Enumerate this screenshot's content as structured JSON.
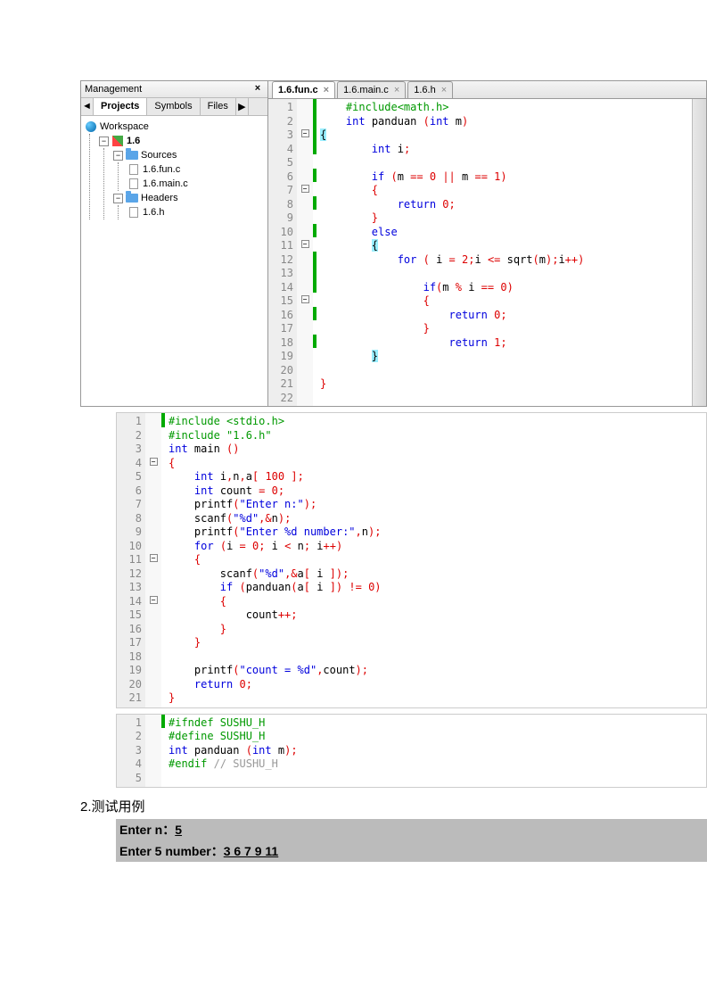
{
  "mgmt": {
    "title": "Management",
    "tabs": [
      "Projects",
      "Symbols",
      "Files"
    ],
    "active_tab": 0,
    "tree": {
      "workspace": "Workspace",
      "project": "1.6",
      "sources": "Sources",
      "source_files": [
        "1.6.fun.c",
        "1.6.main.c"
      ],
      "headers": "Headers",
      "header_files": [
        "1.6.h"
      ]
    }
  },
  "editor": {
    "tabs": [
      {
        "label": "1.6.fun.c",
        "active": true
      },
      {
        "label": "1.6.main.c",
        "active": false
      },
      {
        "label": "1.6.h",
        "active": false
      }
    ]
  },
  "code1": {
    "lines": [
      {
        "n": 1,
        "fold": "",
        "chg": "g",
        "tokens": [
          [
            "    ",
            ""
          ],
          [
            "#include<math.h>",
            "kw-pp"
          ]
        ]
      },
      {
        "n": 2,
        "fold": "",
        "chg": "g",
        "tokens": [
          [
            "    ",
            ""
          ],
          [
            "int",
            "kw-blue"
          ],
          [
            " panduan ",
            ""
          ],
          [
            "(",
            "kw-red"
          ],
          [
            "int",
            "kw-blue"
          ],
          [
            " m",
            ""
          ],
          [
            ")",
            "kw-red"
          ]
        ]
      },
      {
        "n": 3,
        "fold": "-",
        "chg": "g",
        "tokens": [
          [
            "{",
            "kw-hl"
          ]
        ]
      },
      {
        "n": 4,
        "fold": "",
        "chg": "g",
        "tokens": [
          [
            "        ",
            ""
          ],
          [
            "int",
            "kw-blue"
          ],
          [
            " i",
            ""
          ],
          [
            ";",
            "kw-red"
          ]
        ]
      },
      {
        "n": 5,
        "fold": "",
        "chg": "",
        "tokens": [
          [
            "",
            ""
          ]
        ]
      },
      {
        "n": 6,
        "fold": "",
        "chg": "g",
        "tokens": [
          [
            "        ",
            ""
          ],
          [
            "if",
            "kw-blue"
          ],
          [
            " ",
            ""
          ],
          [
            "(",
            "kw-red"
          ],
          [
            "m ",
            ""
          ],
          [
            "==",
            "kw-red"
          ],
          [
            " ",
            ""
          ],
          [
            "0",
            "kw-red2"
          ],
          [
            " ",
            ""
          ],
          [
            "||",
            "kw-red"
          ],
          [
            " m ",
            ""
          ],
          [
            "==",
            "kw-red"
          ],
          [
            " ",
            ""
          ],
          [
            "1",
            "kw-red2"
          ],
          [
            ")",
            "kw-red"
          ]
        ]
      },
      {
        "n": 7,
        "fold": "-",
        "chg": "",
        "tokens": [
          [
            "        ",
            ""
          ],
          [
            "{",
            "kw-red"
          ]
        ]
      },
      {
        "n": 8,
        "fold": "",
        "chg": "g",
        "tokens": [
          [
            "            ",
            ""
          ],
          [
            "return",
            "kw-blue"
          ],
          [
            " ",
            ""
          ],
          [
            "0",
            "kw-red2"
          ],
          [
            ";",
            "kw-red"
          ]
        ]
      },
      {
        "n": 9,
        "fold": "",
        "chg": "",
        "tokens": [
          [
            "        ",
            ""
          ],
          [
            "}",
            "kw-red"
          ]
        ]
      },
      {
        "n": 10,
        "fold": "",
        "chg": "g",
        "tokens": [
          [
            "        ",
            ""
          ],
          [
            "else",
            "kw-blue"
          ]
        ]
      },
      {
        "n": 11,
        "fold": "-",
        "chg": "",
        "tokens": [
          [
            "        ",
            ""
          ],
          [
            "{",
            "kw-hl"
          ]
        ]
      },
      {
        "n": 12,
        "fold": "",
        "chg": "g",
        "tokens": [
          [
            "            ",
            ""
          ],
          [
            "for",
            "kw-blue"
          ],
          [
            " ",
            ""
          ],
          [
            "(",
            "kw-red"
          ],
          [
            " i ",
            ""
          ],
          [
            "=",
            "kw-red"
          ],
          [
            " ",
            ""
          ],
          [
            "2",
            "kw-red2"
          ],
          [
            ";",
            "kw-red"
          ],
          [
            "i ",
            ""
          ],
          [
            "<=",
            "kw-red"
          ],
          [
            " sqrt",
            ""
          ],
          [
            "(",
            "kw-red"
          ],
          [
            "m",
            ""
          ],
          [
            ");",
            "kw-red"
          ],
          [
            "i",
            ""
          ],
          [
            "++)",
            "kw-red"
          ]
        ]
      },
      {
        "n": 13,
        "fold": "",
        "chg": "g",
        "tokens": [
          [
            "",
            ""
          ]
        ]
      },
      {
        "n": 14,
        "fold": "",
        "chg": "g",
        "tokens": [
          [
            "                ",
            ""
          ],
          [
            "if",
            "kw-blue"
          ],
          [
            "(",
            "kw-red"
          ],
          [
            "m ",
            ""
          ],
          [
            "%",
            "kw-red"
          ],
          [
            " i ",
            ""
          ],
          [
            "==",
            "kw-red"
          ],
          [
            " ",
            ""
          ],
          [
            "0",
            "kw-red2"
          ],
          [
            ")",
            "kw-red"
          ]
        ]
      },
      {
        "n": 15,
        "fold": "-",
        "chg": "",
        "tokens": [
          [
            "                ",
            ""
          ],
          [
            "{",
            "kw-red"
          ]
        ]
      },
      {
        "n": 16,
        "fold": "",
        "chg": "g",
        "tokens": [
          [
            "                    ",
            ""
          ],
          [
            "return",
            "kw-blue"
          ],
          [
            " ",
            ""
          ],
          [
            "0",
            "kw-red2"
          ],
          [
            ";",
            "kw-red"
          ]
        ]
      },
      {
        "n": 17,
        "fold": "",
        "chg": "",
        "tokens": [
          [
            "                ",
            ""
          ],
          [
            "}",
            "kw-red"
          ]
        ]
      },
      {
        "n": 18,
        "fold": "",
        "chg": "g",
        "tokens": [
          [
            "                    ",
            ""
          ],
          [
            "return",
            "kw-blue"
          ],
          [
            " ",
            ""
          ],
          [
            "1",
            "kw-red2"
          ],
          [
            ";",
            "kw-red"
          ]
        ]
      },
      {
        "n": 19,
        "fold": "",
        "chg": "",
        "tokens": [
          [
            "        ",
            ""
          ],
          [
            "}",
            "kw-hl"
          ]
        ]
      },
      {
        "n": 20,
        "fold": "",
        "chg": "",
        "tokens": [
          [
            "",
            ""
          ]
        ]
      },
      {
        "n": 21,
        "fold": "",
        "chg": "",
        "tokens": [
          [
            "}",
            "kw-red"
          ]
        ]
      },
      {
        "n": 22,
        "fold": "",
        "chg": "",
        "tokens": [
          [
            "",
            ""
          ]
        ]
      }
    ]
  },
  "code2": {
    "lines": [
      {
        "n": 1,
        "fold": "",
        "chg": "g",
        "tokens": [
          [
            "#include <stdio.h>",
            "kw-pp"
          ]
        ]
      },
      {
        "n": 2,
        "fold": "",
        "chg": "",
        "tokens": [
          [
            "#include \"1.6.h\"",
            "kw-pp"
          ]
        ]
      },
      {
        "n": 3,
        "fold": "",
        "chg": "",
        "tokens": [
          [
            "int",
            "kw-blue"
          ],
          [
            " main ",
            ""
          ],
          [
            "()",
            "kw-red"
          ]
        ]
      },
      {
        "n": 4,
        "fold": "-",
        "chg": "",
        "tokens": [
          [
            "{",
            "kw-red"
          ]
        ]
      },
      {
        "n": 5,
        "fold": "",
        "chg": "",
        "tokens": [
          [
            "    ",
            ""
          ],
          [
            "int",
            "kw-blue"
          ],
          [
            " i",
            ""
          ],
          [
            ",",
            "kw-red"
          ],
          [
            "n",
            ""
          ],
          [
            ",",
            "kw-red"
          ],
          [
            "a",
            ""
          ],
          [
            "[",
            "kw-red"
          ],
          [
            " ",
            ""
          ],
          [
            "100",
            "kw-red2"
          ],
          [
            " ",
            ""
          ],
          [
            "];",
            "kw-red"
          ]
        ]
      },
      {
        "n": 6,
        "fold": "",
        "chg": "",
        "tokens": [
          [
            "    ",
            ""
          ],
          [
            "int",
            "kw-blue"
          ],
          [
            " count ",
            ""
          ],
          [
            "=",
            "kw-red"
          ],
          [
            " ",
            ""
          ],
          [
            "0",
            "kw-red2"
          ],
          [
            ";",
            "kw-red"
          ]
        ]
      },
      {
        "n": 7,
        "fold": "",
        "chg": "",
        "tokens": [
          [
            "    printf",
            ""
          ],
          [
            "(",
            "kw-red"
          ],
          [
            "\"Enter n:\"",
            "kw-blue"
          ],
          [
            ");",
            "kw-red"
          ]
        ]
      },
      {
        "n": 8,
        "fold": "",
        "chg": "",
        "tokens": [
          [
            "    scanf",
            ""
          ],
          [
            "(",
            "kw-red"
          ],
          [
            "\"%d\"",
            "kw-blue"
          ],
          [
            ",&",
            "kw-red"
          ],
          [
            "n",
            ""
          ],
          [
            ");",
            "kw-red"
          ]
        ]
      },
      {
        "n": 9,
        "fold": "",
        "chg": "",
        "tokens": [
          [
            "    printf",
            ""
          ],
          [
            "(",
            "kw-red"
          ],
          [
            "\"Enter %d number:\"",
            "kw-blue"
          ],
          [
            ",",
            "kw-red"
          ],
          [
            "n",
            ""
          ],
          [
            ");",
            "kw-red"
          ]
        ]
      },
      {
        "n": 10,
        "fold": "",
        "chg": "",
        "tokens": [
          [
            "    ",
            ""
          ],
          [
            "for",
            "kw-blue"
          ],
          [
            " ",
            ""
          ],
          [
            "(",
            "kw-red"
          ],
          [
            "i ",
            ""
          ],
          [
            "=",
            "kw-red"
          ],
          [
            " ",
            ""
          ],
          [
            "0",
            "kw-red2"
          ],
          [
            ";",
            "kw-red"
          ],
          [
            " i ",
            ""
          ],
          [
            "<",
            "kw-red"
          ],
          [
            " n",
            ""
          ],
          [
            ";",
            "kw-red"
          ],
          [
            " i",
            ""
          ],
          [
            "++)",
            "kw-red"
          ]
        ]
      },
      {
        "n": 11,
        "fold": "-",
        "chg": "",
        "tokens": [
          [
            "    ",
            ""
          ],
          [
            "{",
            "kw-red"
          ]
        ]
      },
      {
        "n": 12,
        "fold": "",
        "chg": "",
        "tokens": [
          [
            "        scanf",
            ""
          ],
          [
            "(",
            "kw-red"
          ],
          [
            "\"%d\"",
            "kw-blue"
          ],
          [
            ",&",
            "kw-red"
          ],
          [
            "a",
            ""
          ],
          [
            "[",
            "kw-red"
          ],
          [
            " i ",
            ""
          ],
          [
            "]);",
            "kw-red"
          ]
        ]
      },
      {
        "n": 13,
        "fold": "",
        "chg": "",
        "tokens": [
          [
            "        ",
            ""
          ],
          [
            "if",
            "kw-blue"
          ],
          [
            " ",
            ""
          ],
          [
            "(",
            "kw-red"
          ],
          [
            "panduan",
            ""
          ],
          [
            "(",
            "kw-red"
          ],
          [
            "a",
            ""
          ],
          [
            "[",
            "kw-red"
          ],
          [
            " i ",
            ""
          ],
          [
            "])",
            "kw-red"
          ],
          [
            " ",
            ""
          ],
          [
            "!=",
            "kw-red"
          ],
          [
            " ",
            ""
          ],
          [
            "0",
            "kw-red2"
          ],
          [
            ")",
            "kw-red"
          ]
        ]
      },
      {
        "n": 14,
        "fold": "-",
        "chg": "",
        "tokens": [
          [
            "        ",
            ""
          ],
          [
            "{",
            "kw-red"
          ]
        ]
      },
      {
        "n": 15,
        "fold": "",
        "chg": "",
        "tokens": [
          [
            "            count",
            ""
          ],
          [
            "++;",
            "kw-red"
          ]
        ]
      },
      {
        "n": 16,
        "fold": "",
        "chg": "",
        "tokens": [
          [
            "        ",
            ""
          ],
          [
            "}",
            "kw-red"
          ]
        ]
      },
      {
        "n": 17,
        "fold": "",
        "chg": "",
        "tokens": [
          [
            "    ",
            ""
          ],
          [
            "}",
            "kw-red"
          ]
        ]
      },
      {
        "n": 18,
        "fold": "",
        "chg": "",
        "tokens": [
          [
            "",
            ""
          ]
        ]
      },
      {
        "n": 19,
        "fold": "",
        "chg": "",
        "tokens": [
          [
            "    printf",
            ""
          ],
          [
            "(",
            "kw-red"
          ],
          [
            "\"count = %d\"",
            "kw-blue"
          ],
          [
            ",",
            "kw-red"
          ],
          [
            "count",
            ""
          ],
          [
            ");",
            "kw-red"
          ]
        ]
      },
      {
        "n": 20,
        "fold": "",
        "chg": "",
        "tokens": [
          [
            "    ",
            ""
          ],
          [
            "return",
            "kw-blue"
          ],
          [
            " ",
            ""
          ],
          [
            "0",
            "kw-red2"
          ],
          [
            ";",
            "kw-red"
          ]
        ]
      },
      {
        "n": 21,
        "fold": "",
        "chg": "",
        "tokens": [
          [
            "}",
            "kw-red"
          ]
        ]
      }
    ]
  },
  "code3": {
    "lines": [
      {
        "n": 1,
        "fold": "",
        "chg": "g",
        "tokens": [
          [
            "#ifndef SUSHU_H",
            "kw-pp"
          ]
        ]
      },
      {
        "n": 2,
        "fold": "",
        "chg": "",
        "tokens": [
          [
            "#define SUSHU_H",
            "kw-pp"
          ]
        ]
      },
      {
        "n": 3,
        "fold": "",
        "chg": "",
        "tokens": [
          [
            "int",
            "kw-blue"
          ],
          [
            " panduan ",
            ""
          ],
          [
            "(",
            "kw-red"
          ],
          [
            "int",
            "kw-blue"
          ],
          [
            " m",
            ""
          ],
          [
            ");",
            "kw-red"
          ]
        ]
      },
      {
        "n": 4,
        "fold": "",
        "chg": "",
        "tokens": [
          [
            "#endif",
            "kw-pp"
          ],
          [
            " ",
            ""
          ],
          [
            "// SUSHU_H",
            "kw-comment"
          ]
        ]
      },
      {
        "n": 5,
        "fold": "",
        "chg": "",
        "tokens": [
          [
            "",
            ""
          ]
        ]
      }
    ]
  },
  "section2": "2.测试用例",
  "test": {
    "row1_label": "Enter   n：",
    "row1_val": "5",
    "row2_label": "Enter   5 number：",
    "row2_val": "3   6   7   9   11"
  }
}
